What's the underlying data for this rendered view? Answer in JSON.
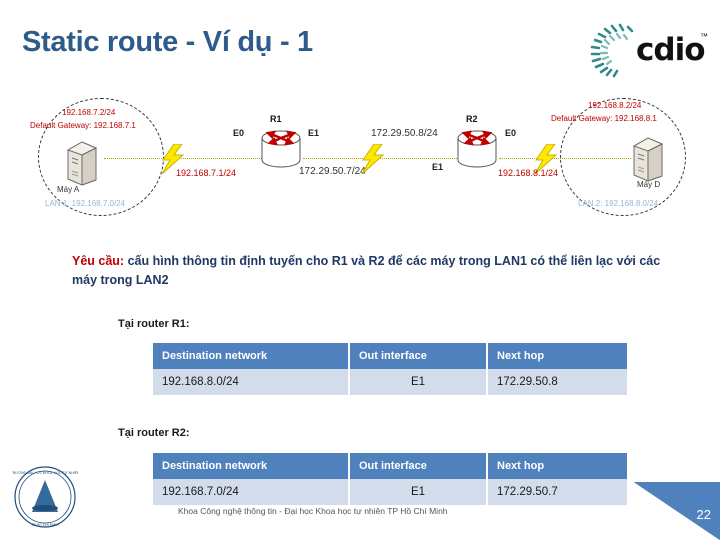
{
  "slide": {
    "title": "Static route - Ví dụ - 1",
    "page_number": "22",
    "footer": "Khoa Công nghệ thông tin - Đại học Khoa học tự nhiên TP Hồ Chí Minh",
    "accent_blue": "#4F81BD",
    "title_color": "#2E5C8A",
    "ip_color": "#C00000"
  },
  "logos": {
    "cdio_text": "cdio",
    "cdio_tm": "™",
    "seal_name": "university-seal-logo"
  },
  "diagram": {
    "lan_left": {
      "host_ip": "192.168.7.2/24",
      "host_gateway": "Default Gateway: 192.168.7.1",
      "host_name": "Máy A",
      "lan_label": "LAN 1: 192.168.7.0/24"
    },
    "lan_right": {
      "host_ip": "192.168.8.2/24",
      "host_gateway": "Default Gateway: 192.168.8.1",
      "host_name": "Máy D",
      "lan_label": "LAN 2: 192.168.8.0/24"
    },
    "router1": {
      "name": "R1",
      "iface_left": "E0",
      "iface_right": "E1",
      "net_left": "192.168.7.1/24",
      "net_right": "172.29.50.7/24"
    },
    "router2": {
      "name": "R2",
      "iface_left": "E1",
      "iface_right": "E0",
      "net_left": "172.29.50.8/24",
      "net_right": "192.168.8.1/24"
    }
  },
  "requirement": {
    "label": "Yêu cầu:",
    "text": " cấu hình thông tin định tuyến cho R1 và R2 để các máy trong LAN1 có thể liên lạc với các máy trong LAN2"
  },
  "tables": [
    {
      "heading": "Tại router R1:",
      "columns": [
        "Destination network",
        "Out interface",
        "Next hop"
      ],
      "rows": [
        [
          "192.168.8.0/24",
          "E1",
          "172.29.50.8"
        ]
      ]
    },
    {
      "heading": "Tại router R2:",
      "columns": [
        "Destination network",
        "Out interface",
        "Next hop"
      ],
      "rows": [
        [
          "192.168.7.0/24",
          "E1",
          "172.29.50.7"
        ]
      ]
    }
  ]
}
